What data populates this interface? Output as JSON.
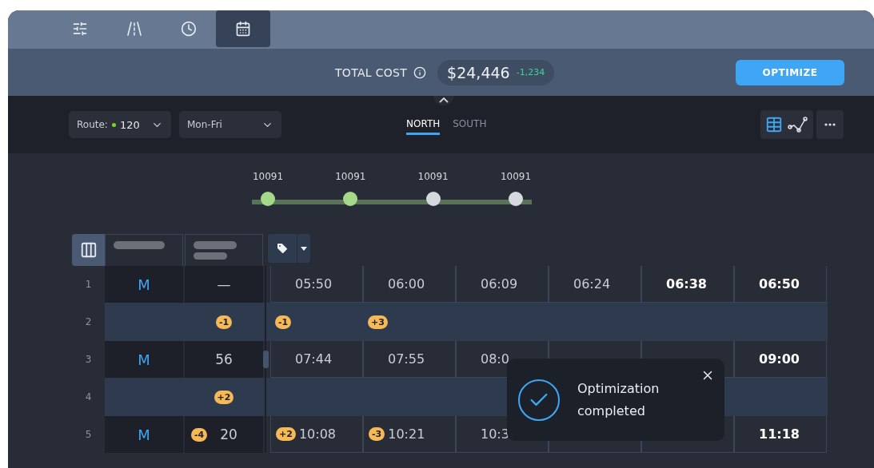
{
  "tabs": [
    {
      "selected": false
    },
    {
      "selected": false
    },
    {
      "selected": false
    },
    {
      "selected": true
    }
  ],
  "cost": {
    "label": "TOTAL COST",
    "value": "$24,446",
    "delta": "-1,234"
  },
  "optimize_button": "OPTIMIZE",
  "route_select": {
    "label": "Route:",
    "value": "120"
  },
  "days_select": {
    "value": "Mon-Fri"
  },
  "direction_tabs": [
    {
      "label": "NORTH",
      "selected": true
    },
    {
      "label": "SOUTH",
      "selected": false
    }
  ],
  "view_toggle": [
    {
      "selected": true
    },
    {
      "selected": false
    }
  ],
  "stops": [
    {
      "label": "10091",
      "reached": true
    },
    {
      "label": "10091",
      "reached": true
    },
    {
      "label": "10091",
      "reached": false
    },
    {
      "label": "10091",
      "reached": false
    }
  ],
  "table": {
    "rows": [
      {
        "number": "1",
        "kind": "trip",
        "type": "M",
        "count": {
          "text": "—"
        },
        "times": [
          {
            "text": "05:50",
            "bold": false
          },
          {
            "text": "06:00",
            "bold": false
          },
          {
            "text": "06:09",
            "bold": false
          },
          {
            "text": "06:24",
            "bold": false
          },
          {
            "text": "06:38",
            "bold": true
          },
          {
            "text": "06:50",
            "bold": true
          }
        ]
      },
      {
        "number": "2",
        "kind": "adjust",
        "count": {
          "badge": "-1"
        },
        "times": [
          {
            "badge": "-1"
          },
          {
            "badge": "+3"
          }
        ]
      },
      {
        "number": "3",
        "kind": "trip",
        "type": "M",
        "count": {
          "text": "56"
        },
        "times": [
          {
            "text": "07:44",
            "bold": false
          },
          {
            "text": "07:55",
            "bold": false
          },
          {
            "text": "08:0",
            "bold": false
          },
          {
            "text": "09:00",
            "bold": true
          }
        ]
      },
      {
        "number": "4",
        "kind": "adjust",
        "count": {
          "badge": "+2"
        }
      },
      {
        "number": "5",
        "kind": "trip",
        "type": "M",
        "count": {
          "badge": "-4",
          "text": "20"
        },
        "times": [
          {
            "badge": "+2",
            "text": "10:08",
            "bold": false
          },
          {
            "badge": "-3",
            "text": "10:21",
            "bold": false
          },
          {
            "text": "10:3",
            "bold": false
          },
          {
            "text": "11:18",
            "bold": true
          }
        ]
      }
    ]
  },
  "toast": {
    "message": "Optimization completed"
  }
}
